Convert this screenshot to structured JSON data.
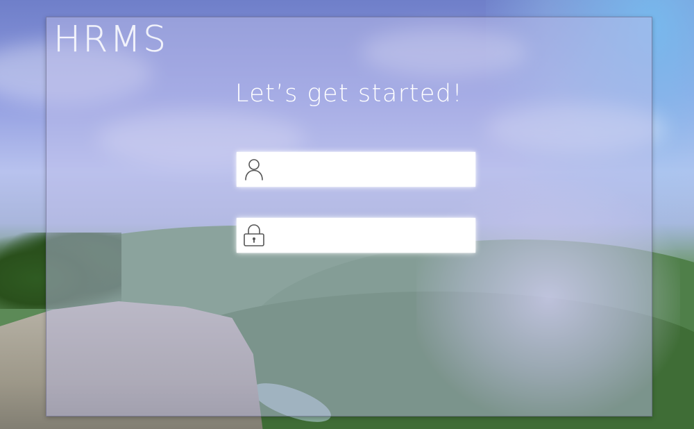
{
  "app": {
    "brand": "HRMS"
  },
  "login": {
    "heading": "Let’s get started!",
    "username": {
      "value": "",
      "placeholder": "",
      "icon": "user-icon"
    },
    "password": {
      "value": "",
      "placeholder": "",
      "icon": "lock-icon"
    }
  },
  "colors": {
    "panel_tint": "#bebeeb",
    "text": "#ffffff",
    "field_bg": "#ffffff",
    "icon_stroke": "#555555"
  }
}
